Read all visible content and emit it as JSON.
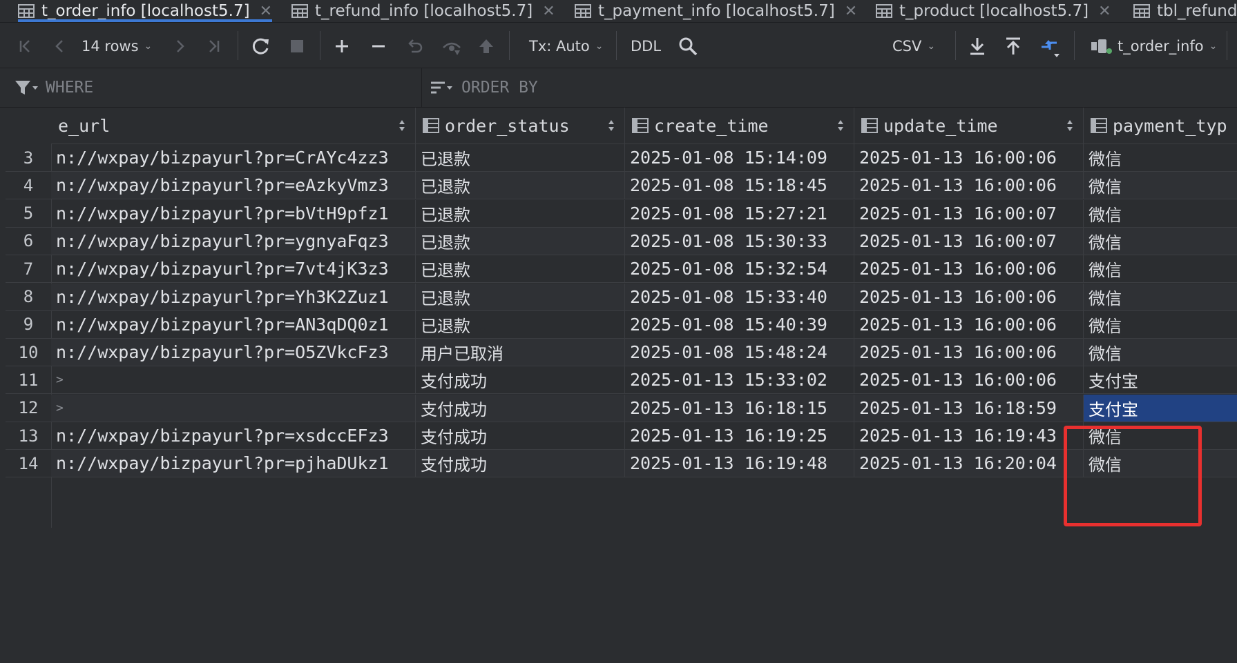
{
  "tabs": [
    {
      "label": "t_order_info [localhost5.7]",
      "active": true
    },
    {
      "label": "t_refund_info [localhost5.7]",
      "active": false
    },
    {
      "label": "t_payment_info [localhost5.7]",
      "active": false
    },
    {
      "label": "t_product [localhost5.7]",
      "active": false
    },
    {
      "label": "tbl_refund",
      "active": false
    }
  ],
  "toolbar": {
    "rows_label": "14 rows",
    "tx_label": "Tx: Auto",
    "ddl_label": "DDL",
    "export_format": "CSV",
    "datasource_label": "t_order_info"
  },
  "filters": {
    "where_placeholder": "WHERE",
    "order_by_placeholder": "ORDER BY"
  },
  "columns": [
    {
      "label": "e_url"
    },
    {
      "label": "order_status"
    },
    {
      "label": "create_time"
    },
    {
      "label": "update_time"
    },
    {
      "label": "payment_typ"
    }
  ],
  "rows": [
    {
      "num": "3",
      "url": "n://wxpay/bizpayurl?pr=CrAYc4zz3",
      "status": "已退款",
      "create": "2025-01-08 15:14:09",
      "update": "2025-01-13 16:00:06",
      "payment": "微信"
    },
    {
      "num": "4",
      "url": "n://wxpay/bizpayurl?pr=eAzkyVmz3",
      "status": "已退款",
      "create": "2025-01-08 15:18:45",
      "update": "2025-01-13 16:00:06",
      "payment": "微信"
    },
    {
      "num": "5",
      "url": "n://wxpay/bizpayurl?pr=bVtH9pfz1",
      "status": "已退款",
      "create": "2025-01-08 15:27:21",
      "update": "2025-01-13 16:00:07",
      "payment": "微信"
    },
    {
      "num": "6",
      "url": "n://wxpay/bizpayurl?pr=ygnyaFqz3",
      "status": "已退款",
      "create": "2025-01-08 15:30:33",
      "update": "2025-01-13 16:00:07",
      "payment": "微信"
    },
    {
      "num": "7",
      "url": "n://wxpay/bizpayurl?pr=7vt4jK3z3",
      "status": "已退款",
      "create": "2025-01-08 15:32:54",
      "update": "2025-01-13 16:00:06",
      "payment": "微信"
    },
    {
      "num": "8",
      "url": "n://wxpay/bizpayurl?pr=Yh3K2Zuz1",
      "status": "已退款",
      "create": "2025-01-08 15:33:40",
      "update": "2025-01-13 16:00:06",
      "payment": "微信"
    },
    {
      "num": "9",
      "url": "n://wxpay/bizpayurl?pr=AN3qDQ0z1",
      "status": "已退款",
      "create": "2025-01-08 15:40:39",
      "update": "2025-01-13 16:00:06",
      "payment": "微信"
    },
    {
      "num": "10",
      "url": "n://wxpay/bizpayurl?pr=O5ZVkcFz3",
      "status": "用户已取消",
      "create": "2025-01-08 15:48:24",
      "update": "2025-01-13 16:00:06",
      "payment": "微信"
    },
    {
      "num": "11",
      "url": ">",
      "status": "支付成功",
      "create": "2025-01-13 15:33:02",
      "update": "2025-01-13 16:00:06",
      "payment": "支付宝"
    },
    {
      "num": "12",
      "url": ">",
      "status": "支付成功",
      "create": "2025-01-13 16:18:15",
      "update": "2025-01-13 16:18:59",
      "payment": "支付宝",
      "selected": true
    },
    {
      "num": "13",
      "url": "n://wxpay/bizpayurl?pr=xsdccEFz3",
      "status": "支付成功",
      "create": "2025-01-13 16:19:25",
      "update": "2025-01-13 16:19:43",
      "payment": "微信"
    },
    {
      "num": "14",
      "url": "n://wxpay/bizpayurl?pr=pjhaDUkz1",
      "status": "支付成功",
      "create": "2025-01-13 16:19:48",
      "update": "2025-01-13 16:20:04",
      "payment": "微信"
    }
  ],
  "colors": {
    "background": "#2b2d30",
    "selection": "#214283",
    "active_tab_underline": "#3d79d4",
    "annotation_box": "#e8302f"
  },
  "icons": [
    "table-icon",
    "close-icon",
    "first-page-icon",
    "prev-page-icon",
    "next-page-icon",
    "last-page-icon",
    "reload-icon",
    "stop-icon",
    "add-row-icon",
    "delete-row-icon",
    "revert-icon",
    "preview-icon",
    "submit-icon",
    "search-icon",
    "download-icon",
    "upload-icon",
    "compare-icon",
    "datasource-icon",
    "filter-icon",
    "sort-icon",
    "column-icon",
    "sort-arrows-icon"
  ]
}
